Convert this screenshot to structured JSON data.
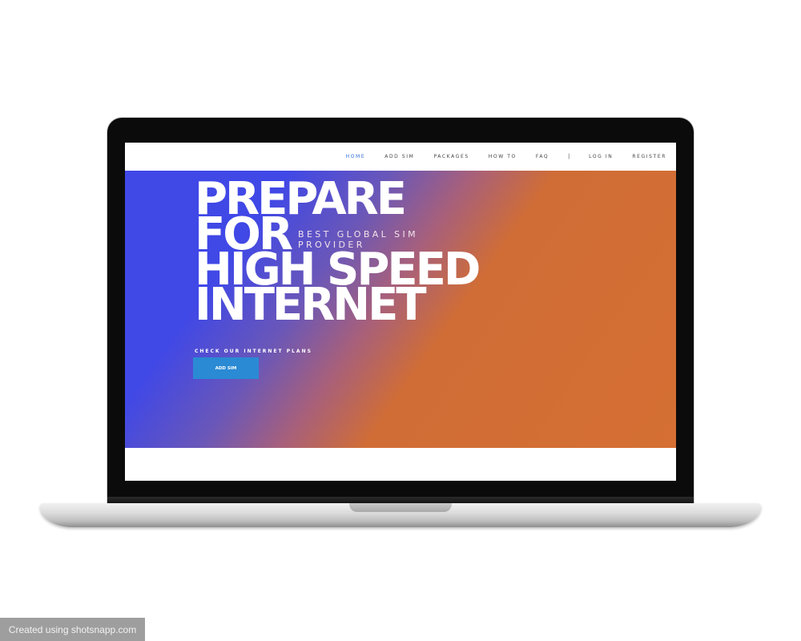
{
  "nav": {
    "items": [
      {
        "label": "HOME",
        "active": true
      },
      {
        "label": "ADD SIM",
        "active": false
      },
      {
        "label": "PACKAGES",
        "active": false
      },
      {
        "label": "HOW TO",
        "active": false
      },
      {
        "label": "FAQ",
        "active": false
      }
    ],
    "separator": "|",
    "login": "LOG IN",
    "register": "REGISTER"
  },
  "hero": {
    "lines": [
      "PREPARE",
      "FOR",
      "HIGH SPEED",
      "INTERNET"
    ],
    "subtitle_line1": "BEST GLOBAL SIM",
    "subtitle_line2": "PROVIDER",
    "cta_text": "CHECK OUR INTERNET PLANS",
    "cta_button": "ADD SIM",
    "gradient_colors": [
      "#4048e6",
      "#d56f33"
    ],
    "button_color": "#2a8ad4"
  },
  "watermark": "Created using shotsnapp.com"
}
